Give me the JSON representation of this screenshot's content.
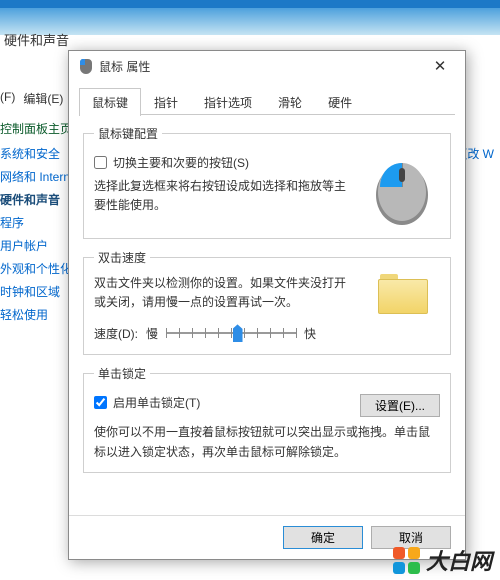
{
  "controlPanel": {
    "title": "硬件和声音",
    "menu": {
      "file": "(F)",
      "edit": "编辑(E)"
    },
    "sidebar": {
      "header": "控制面板主页",
      "links": [
        "系统和安全",
        "网络和 Internet",
        "硬件和声音",
        "程序",
        "用户帐户",
        "外观和个性化",
        "时钟和区域",
        "轻松使用"
      ],
      "currentIndex": 2
    },
    "rightLink": "更改 W"
  },
  "dialog": {
    "title": "鼠标 属性",
    "closeGlyph": "✕",
    "tabs": [
      "鼠标键",
      "指针",
      "指针选项",
      "滑轮",
      "硬件"
    ],
    "activeTab": 0,
    "groups": {
      "config": {
        "legend": "鼠标键配置",
        "checkboxLabel": "切换主要和次要的按钮(S)",
        "checked": false,
        "desc": "选择此复选框来将右按钮设成如选择和拖放等主要性能使用。"
      },
      "speed": {
        "legend": "双击速度",
        "desc": "双击文件夹以检测你的设置。如果文件夹没打开或关闭，请用慢一点的设置再试一次。",
        "labelSpeed": "速度(D):",
        "slow": "慢",
        "fast": "快",
        "value": 55
      },
      "clicklock": {
        "legend": "单击锁定",
        "checkboxLabel": "启用单击锁定(T)",
        "checked": true,
        "settingsBtn": "设置(E)...",
        "desc": "使你可以不用一直按着鼠标按钮就可以突出显示或拖拽。单击鼠标以进入锁定状态，再次单击鼠标可解除锁定。"
      }
    },
    "footer": {
      "ok": "确定",
      "cancel": "取消"
    }
  },
  "watermark": "大白网"
}
